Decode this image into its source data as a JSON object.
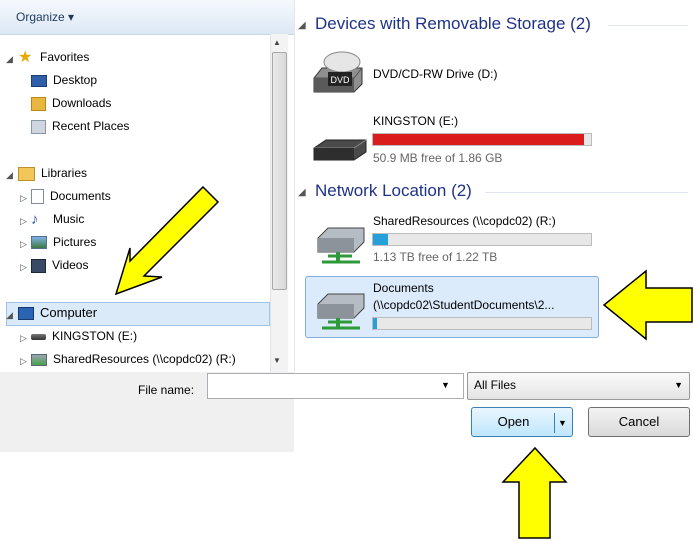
{
  "toolbar": {
    "organize_label": "Organize ▾"
  },
  "nav": {
    "favorites": {
      "label": "Favorites",
      "items": [
        "Desktop",
        "Downloads",
        "Recent Places"
      ]
    },
    "libraries": {
      "label": "Libraries",
      "items": [
        "Documents",
        "Music",
        "Pictures",
        "Videos"
      ]
    },
    "computer": {
      "label": "Computer",
      "items": [
        "KINGSTON (E:)",
        "SharedResources (\\\\copdc02) (R:)"
      ]
    }
  },
  "groups": {
    "removable": {
      "title": "Devices with Removable Storage (2)",
      "drives": [
        {
          "name": "DVD/CD-RW Drive (D:)",
          "icon_label": "DVD"
        },
        {
          "name": "KINGSTON (E:)",
          "free": "50.9 MB free of 1.86 GB",
          "used_fraction": 0.97,
          "bar_color": "#da1c1c"
        }
      ]
    },
    "network": {
      "title": "Network Location (2)",
      "drives": [
        {
          "name": "SharedResources (\\\\copdc02) (R:)",
          "free": "1.13 TB free of 1.22 TB",
          "used_fraction": 0.07,
          "bar_color": "#26a0da"
        },
        {
          "name": "Documents",
          "path": "(\\\\copdc02\\StudentDocuments\\2...",
          "used_fraction": 0.02,
          "bar_color": "#26a0da"
        }
      ]
    }
  },
  "footer": {
    "filename_label": "File name:",
    "filename_value": "",
    "filetype_value": "All Files",
    "open_label": "Open",
    "cancel_label": "Cancel"
  },
  "colors": {
    "arrow_fill": "#ffff00",
    "arrow_stroke": "#000000",
    "group_title": "#1e3287"
  }
}
